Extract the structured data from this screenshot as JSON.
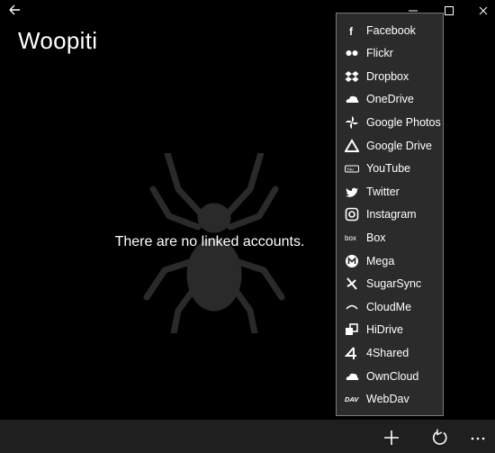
{
  "app": {
    "title": "Woopiti"
  },
  "main": {
    "empty_message": "There are no linked accounts."
  },
  "menu": {
    "items": [
      {
        "label": "Facebook",
        "icon": "facebook-icon"
      },
      {
        "label": "Flickr",
        "icon": "flickr-icon"
      },
      {
        "label": "Dropbox",
        "icon": "dropbox-icon"
      },
      {
        "label": "OneDrive",
        "icon": "onedrive-icon"
      },
      {
        "label": "Google Photos",
        "icon": "google-photos-icon"
      },
      {
        "label": "Google Drive",
        "icon": "google-drive-icon"
      },
      {
        "label": "YouTube",
        "icon": "youtube-icon"
      },
      {
        "label": "Twitter",
        "icon": "twitter-icon"
      },
      {
        "label": "Instagram",
        "icon": "instagram-icon"
      },
      {
        "label": "Box",
        "icon": "box-icon"
      },
      {
        "label": "Mega",
        "icon": "mega-icon"
      },
      {
        "label": "SugarSync",
        "icon": "sugarsync-icon"
      },
      {
        "label": "CloudMe",
        "icon": "cloudme-icon"
      },
      {
        "label": "HiDrive",
        "icon": "hidrive-icon"
      },
      {
        "label": "4Shared",
        "icon": "4shared-icon"
      },
      {
        "label": "OwnCloud",
        "icon": "owncloud-icon"
      },
      {
        "label": "WebDav",
        "icon": "webdav-icon"
      }
    ]
  },
  "colors": {
    "background": "#000000",
    "menu_bg": "#2b2b2b",
    "menu_border": "#7a7a7a",
    "bottom_bar": "#1f1f1f",
    "spider": "#2a2a2a"
  }
}
